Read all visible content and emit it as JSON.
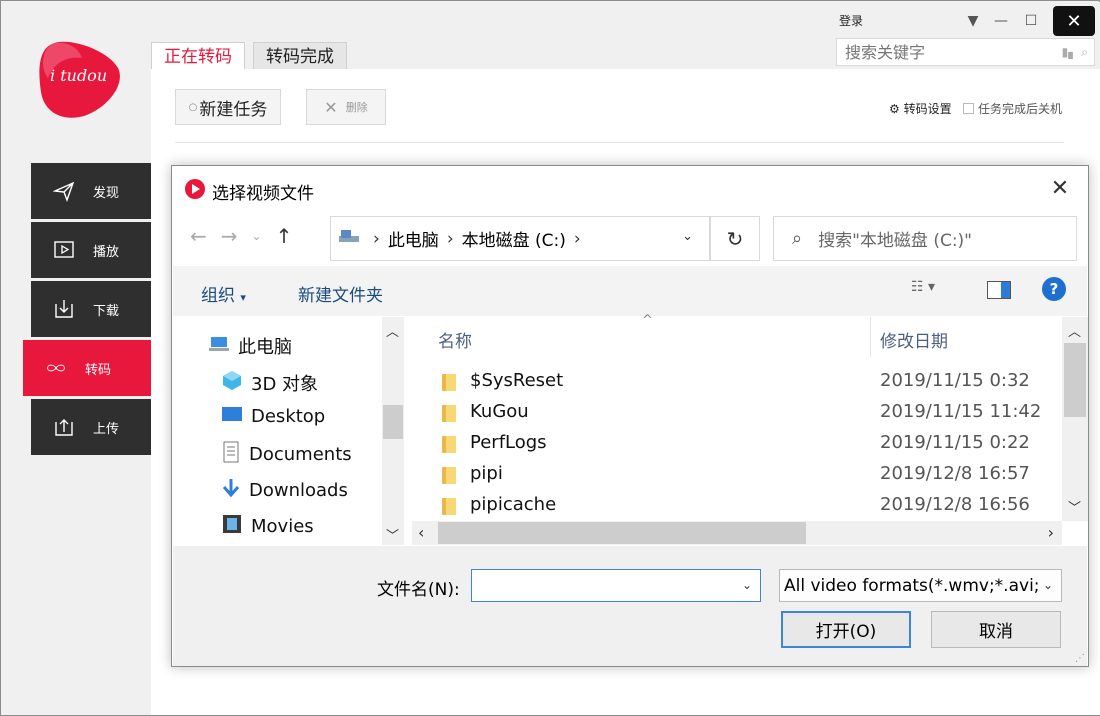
{
  "app": {
    "logo_text": "i tudou",
    "login_label": "登录",
    "search_placeholder": "搜索关键字",
    "tabs": [
      {
        "label": "正在转码"
      },
      {
        "label": "转码完成"
      }
    ],
    "nav": [
      {
        "label": "发现",
        "icon": "paper-plane-icon"
      },
      {
        "label": "播放",
        "icon": "play-icon"
      },
      {
        "label": "下载",
        "icon": "download-icon"
      },
      {
        "label": "转码",
        "icon": "infinity-icon"
      },
      {
        "label": "上传",
        "icon": "upload-icon"
      }
    ],
    "new_task_label": "新建任务",
    "delete_label": "删除",
    "settings_label": "转码设置",
    "shutdown_label": "任务完成后关机",
    "brand_color": "#e8173c"
  },
  "dialog": {
    "title": "选择视频文件",
    "address": [
      "此电脑",
      "本地磁盘 (C:)"
    ],
    "search_placeholder": "搜索\"本地磁盘 (C:)\"",
    "organize_label": "组织",
    "new_folder_label": "新建文件夹",
    "tree": [
      {
        "label": "此电脑",
        "icon": "computer-icon"
      },
      {
        "label": "3D 对象",
        "icon": "cube-icon"
      },
      {
        "label": "Desktop",
        "icon": "desktop-icon"
      },
      {
        "label": "Documents",
        "icon": "document-icon"
      },
      {
        "label": "Downloads",
        "icon": "download-arrow-icon"
      },
      {
        "label": "Movies",
        "icon": "film-icon"
      }
    ],
    "columns": {
      "name": "名称",
      "date": "修改日期"
    },
    "files": [
      {
        "name": "$SysReset",
        "date": "2019/11/15 0:32"
      },
      {
        "name": "KuGou",
        "date": "2019/11/15 11:42"
      },
      {
        "name": "PerfLogs",
        "date": "2019/11/15 0:22"
      },
      {
        "name": "pipi",
        "date": "2019/12/8 16:57"
      },
      {
        "name": "pipicache",
        "date": "2019/12/8 16:56"
      }
    ],
    "filename_label": "文件名(N):",
    "filename_value": "",
    "filter_value": "All video formats(*.wmv;*.avi;",
    "open_label": "打开(O)",
    "cancel_label": "取消"
  }
}
